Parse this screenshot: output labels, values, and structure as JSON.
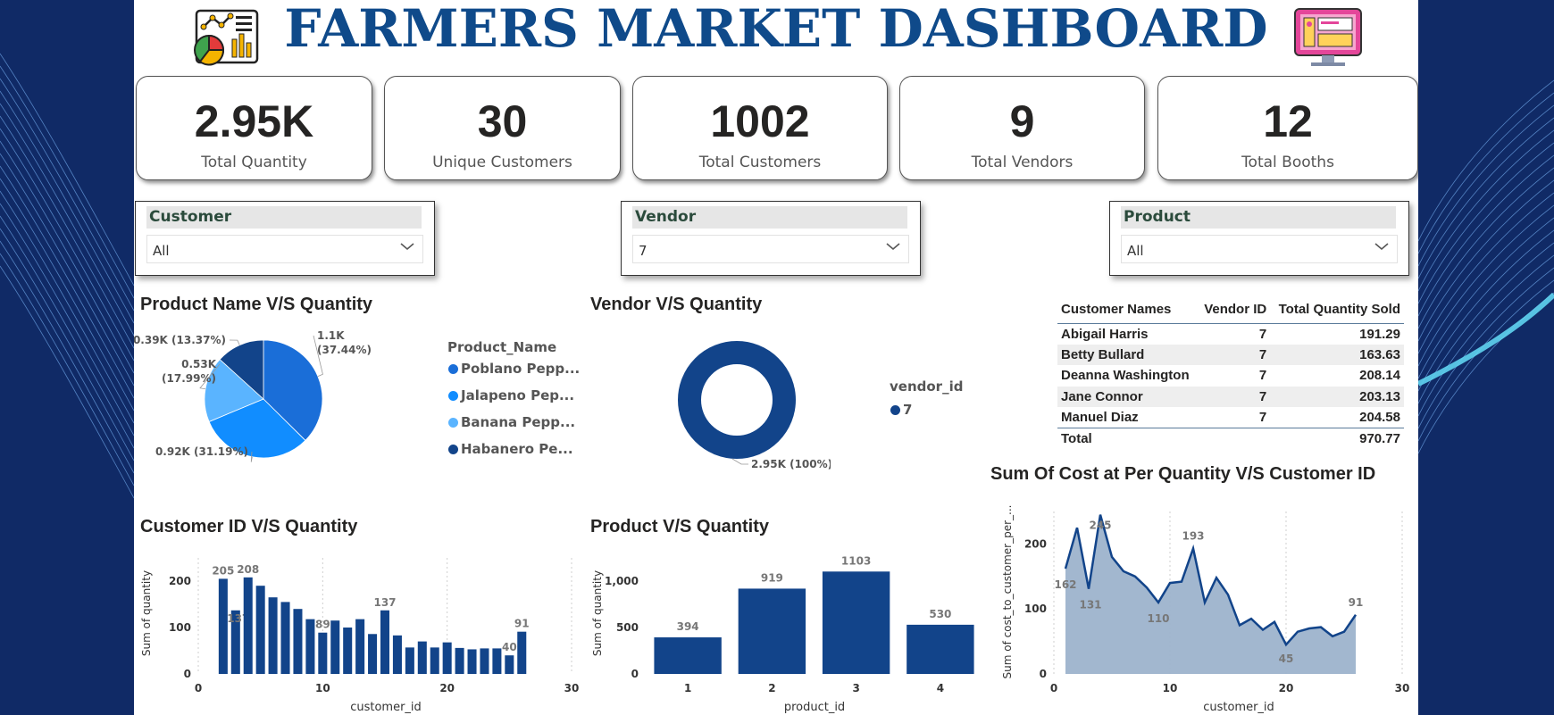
{
  "title": "FARMERS MARKET DASHBOARD",
  "icons": {
    "left": "analytics-chart-icon",
    "right": "monitor-dashboard-icon"
  },
  "colors": {
    "navy": "#0f4a8a",
    "dark_blue": "#12448a",
    "mid_blue": "#1a78e0",
    "light_blue": "#5ab4ff",
    "background": "#0f2560"
  },
  "kpis": [
    {
      "value": "2.95K",
      "label": "Total Quantity"
    },
    {
      "value": "30",
      "label": "Unique Customers"
    },
    {
      "value": "1002",
      "label": "Total Customers"
    },
    {
      "value": "9",
      "label": "Total Vendors"
    },
    {
      "value": "12",
      "label": "Total Booths"
    }
  ],
  "slicers": [
    {
      "header": "Customer",
      "value": "All"
    },
    {
      "header": "Vendor",
      "value": "7"
    },
    {
      "header": "Product",
      "value": "All"
    }
  ],
  "table": {
    "headers": [
      "Customer Names",
      "Vendor ID",
      "Total Quantity Sold"
    ],
    "rows": [
      [
        "Abigail Harris",
        "7",
        "191.29"
      ],
      [
        "Betty Bullard",
        "7",
        "163.63"
      ],
      [
        "Deanna Washington",
        "7",
        "208.14"
      ],
      [
        "Jane Connor",
        "7",
        "203.13"
      ],
      [
        "Manuel Diaz",
        "7",
        "204.58"
      ]
    ],
    "total_label": "Total",
    "total_value": "970.77"
  },
  "chart_data": [
    {
      "type": "pie",
      "title": "Product Name V/S Quantity",
      "legend_title": "Product_Name",
      "legend_position": "right",
      "categories": [
        "Poblano Pepp...",
        "Jalapeno Pep...",
        "Banana Pepp...",
        "Habanero Pe..."
      ],
      "values": [
        1100,
        920,
        530,
        390
      ],
      "percents": [
        37.44,
        31.19,
        17.99,
        13.37
      ],
      "slice_labels": [
        "1.1K (37.44%)",
        "0.92K (31.19%)",
        "0.53K (17.99%)",
        "0.39K (13.37%)"
      ],
      "colors": [
        "#1a6ed8",
        "#118dff",
        "#5ab4ff",
        "#12448a"
      ]
    },
    {
      "type": "pie",
      "title": "Vendor V/S Quantity",
      "legend_title": "vendor_id",
      "legend_position": "right",
      "categories": [
        "7"
      ],
      "values": [
        2950
      ],
      "percents": [
        100
      ],
      "slice_labels": [
        "2.95K (100%)"
      ],
      "colors": [
        "#12448a"
      ]
    },
    {
      "type": "bar",
      "title": "Customer ID V/S Quantity",
      "xlabel": "customer_id",
      "ylabel": "Sum of quantity",
      "xlim": [
        0,
        30
      ],
      "ylim": [
        0,
        250
      ],
      "x_ticks": [
        0,
        10,
        20,
        30
      ],
      "y_ticks": [
        0,
        100,
        200
      ],
      "x": [
        2,
        3,
        4,
        5,
        6,
        7,
        8,
        9,
        10,
        11,
        12,
        13,
        14,
        15,
        16,
        17,
        18,
        19,
        20,
        21,
        22,
        23,
        24,
        25,
        26
      ],
      "values": [
        205,
        137,
        208,
        190,
        165,
        155,
        140,
        118,
        89,
        115,
        100,
        118,
        86,
        137,
        83,
        57,
        70,
        57,
        68,
        56,
        53,
        55,
        55,
        40,
        91
      ],
      "data_labels": {
        "2": "205",
        "3": "137",
        "4": "208",
        "10": "89",
        "15": "137",
        "25": "40",
        "26": "91"
      },
      "color": "#12448a"
    },
    {
      "type": "bar",
      "title": "Product V/S Quantity",
      "xlabel": "product_id",
      "ylabel": "Sum of quantity",
      "ylim": [
        0,
        1250
      ],
      "y_ticks": [
        0,
        500,
        1000
      ],
      "y_tick_labels": [
        "0",
        "500",
        "1,000"
      ],
      "categories": [
        "1",
        "2",
        "3",
        "4"
      ],
      "values": [
        394,
        919,
        1103,
        530
      ],
      "color": "#12448a"
    },
    {
      "type": "area",
      "title": "Sum Of Cost at Per Quantity V/S Customer ID",
      "xlabel": "customer_id",
      "ylabel": "Sum of cost_to_customer_per_...",
      "xlim": [
        0,
        30
      ],
      "ylim": [
        0,
        250
      ],
      "x_ticks": [
        0,
        10,
        20,
        30
      ],
      "y_ticks": [
        0,
        100,
        200
      ],
      "x": [
        1,
        2,
        3,
        4,
        5,
        6,
        7,
        8,
        9,
        10,
        11,
        12,
        13,
        14,
        15,
        16,
        17,
        18,
        19,
        20,
        21,
        22,
        23,
        24,
        25,
        26
      ],
      "values": [
        162,
        225,
        131,
        245,
        180,
        158,
        150,
        133,
        110,
        140,
        142,
        193,
        110,
        148,
        122,
        75,
        85,
        68,
        80,
        45,
        65,
        70,
        72,
        58,
        65,
        91
      ],
      "data_labels": {
        "1": "162",
        "3": "131",
        "4": "245",
        "9": "110",
        "12": "193",
        "20": "45",
        "26": "91"
      },
      "line_color": "#12448a",
      "fill_color": "#9db3cc"
    }
  ]
}
